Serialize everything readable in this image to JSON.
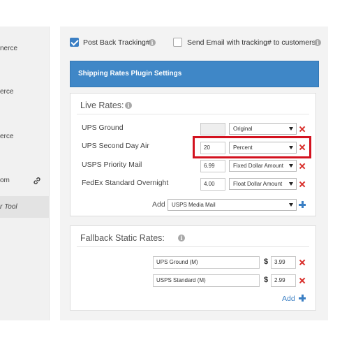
{
  "sidebar": {
    "items": [
      {
        "label": "nerce"
      },
      {
        "label": "erce"
      },
      {
        "label": "erce"
      },
      {
        "label": "om"
      },
      {
        "label": "r Tool"
      }
    ],
    "link_icon": "link-icon"
  },
  "options": {
    "post_back": {
      "label": "Post Back Tracking#",
      "checked": true
    },
    "send_email": {
      "label": "Send Email with tracking# to customers?",
      "checked": false
    }
  },
  "header": {
    "title": "Shipping Rates Plugin Settings",
    "color": "#3f87c7"
  },
  "live_rates": {
    "title": "Live Rates:",
    "rows": [
      {
        "name": "UPS Ground",
        "value": "",
        "mode": "Original"
      },
      {
        "name": "UPS Second Day Air",
        "value": "20",
        "mode": "Percent"
      },
      {
        "name": "USPS Priority Mail",
        "value": "6.99",
        "mode": "Fixed Dollar Amount"
      },
      {
        "name": "FedEx Standard Overnight",
        "value": "4.00",
        "mode": "Float Dollar Amount"
      }
    ],
    "add_label": "Add",
    "add_select": "USPS Media Mail"
  },
  "fallback": {
    "title": "Fallback Static Rates:",
    "rows": [
      {
        "name": "UPS Ground (M)",
        "currency": "$",
        "value": "3.99"
      },
      {
        "name": "USPS Standard (M)",
        "currency": "$",
        "value": "2.99"
      }
    ],
    "add_label": "Add"
  },
  "colors": {
    "accent": "#3b7fc4",
    "delete": "#d9302c",
    "highlight": "#d3121f"
  }
}
